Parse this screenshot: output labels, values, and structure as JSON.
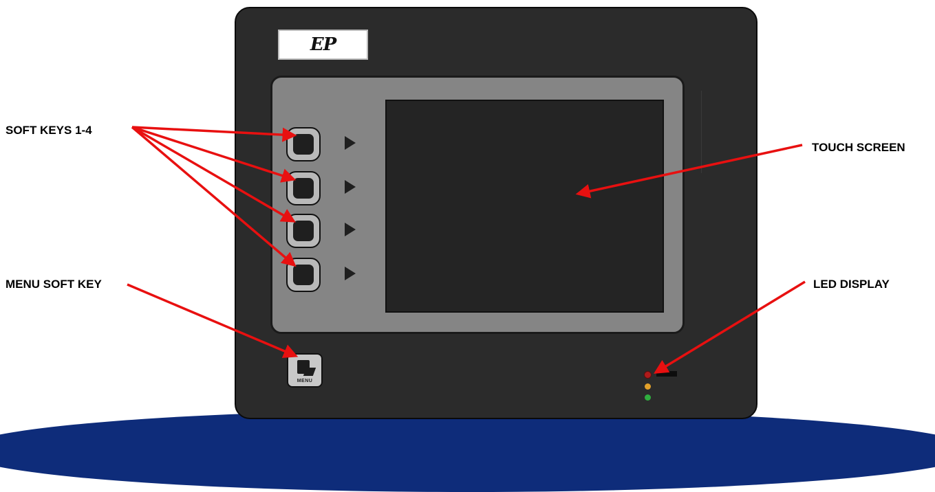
{
  "device": {
    "logo_text": "EP"
  },
  "labels": {
    "soft_keys": "SOFT KEYS 1-4",
    "menu_soft_key": "MENU SOFT KEY",
    "touch_screen": "TOUCH SCREEN",
    "led_display": "LED DISPLAY"
  },
  "menu_key_text": "MENU",
  "colors": {
    "arrow": "#e81010",
    "device_body": "#2b2b2b",
    "panel": "#858585",
    "screen": "#242424",
    "led_red": "#b01b1b",
    "led_amber": "#e2a12a",
    "led_green": "#2fae3f",
    "background_arc": "#0e2c7a"
  }
}
